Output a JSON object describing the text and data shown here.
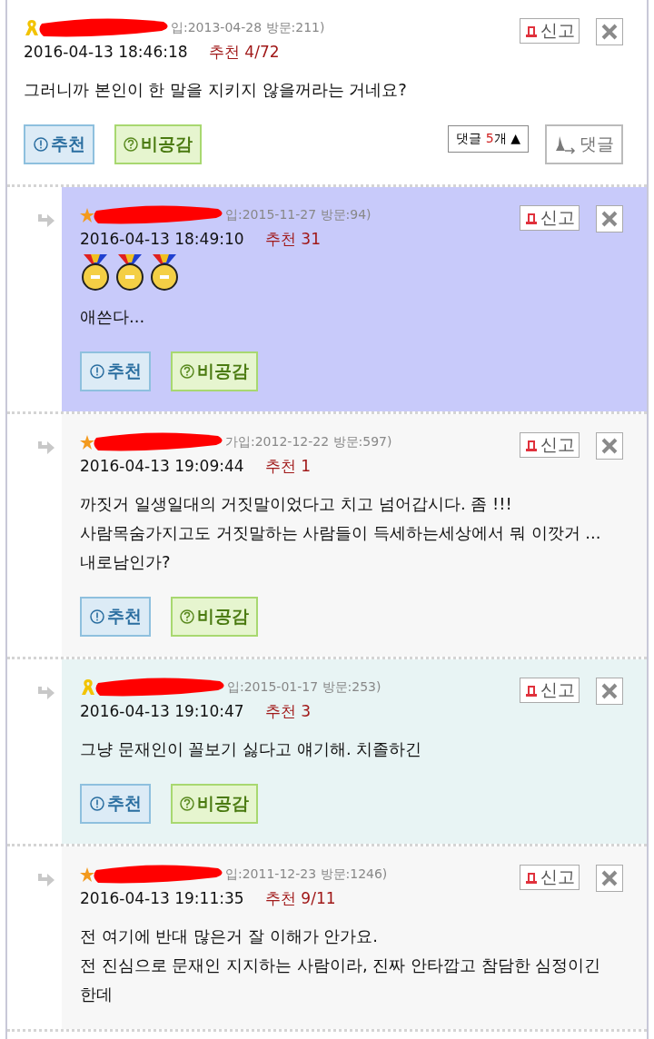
{
  "comments": [
    {
      "badge": {
        "kind": "ribbon"
      },
      "reply": false,
      "color": "#ffffff",
      "meta": "입:2013-04-28 방문:211)",
      "date": "2016-04-13 18:46:18",
      "votes": "추천 4/72",
      "body": [
        "그러니까 본인이 한 말을 지키지 않을꺼라는 거네요?"
      ],
      "report": "신고",
      "recommend": "추천",
      "dislike": "비공감",
      "thread": {
        "label": "댓글",
        "count": "5",
        "unit": "개",
        "arrow": "▲",
        "reply": "댓글"
      }
    },
    {
      "badge": {
        "kind": "star"
      },
      "reply": true,
      "color": "#c8cafa",
      "meta": "입:2015-11-27 방문:94)",
      "date": "2016-04-13 18:49:10",
      "votes": "추천 31",
      "awards": [
        {
          "kind": "medal"
        },
        {
          "kind": "medal"
        },
        {
          "kind": "medal"
        }
      ],
      "body": [
        "애쓴다..."
      ],
      "report": "신고",
      "recommend": "추천",
      "dislike": "비공감"
    },
    {
      "badge": {
        "kind": "star"
      },
      "reply": true,
      "color": "#f7f7f7",
      "meta": "가입:2012-12-22 방문:597)",
      "date": "2016-04-13 19:09:44",
      "votes": "추천 1",
      "body": [
        "까짓거 일생일대의 거짓말이었다고 치고 넘어갑시다. 좀 !!!",
        "사람목숨가지고도 거짓말하는 사람들이 득세하는세상에서 뭐 이깟거 ...",
        "내로남인가?"
      ],
      "report": "신고",
      "recommend": "추천",
      "dislike": "비공감"
    },
    {
      "badge": {
        "kind": "ribbon"
      },
      "reply": true,
      "color": "#e8f4f4",
      "meta": "입:2015-01-17 방문:253)",
      "date": "2016-04-13 19:10:47",
      "votes": "추천 3",
      "body": [
        "그냥 문재인이 꼴보기 싫다고 얘기해. 치졸하긴"
      ],
      "report": "신고",
      "recommend": "추천",
      "dislike": "비공감"
    },
    {
      "badge": {
        "kind": "star"
      },
      "reply": true,
      "color": "#f7f7f7",
      "meta": "입:2011-12-23 방문:1246)",
      "date": "2016-04-13 19:11:35",
      "votes": "추천 9/11",
      "body": [
        "전 여기에 반대 많은거 잘 이해가 안가요.",
        "전 진심으로 문재인 지지하는 사람이라, 진짜 안타깝고 참담한 심정이긴",
        "한데"
      ],
      "report": "신고"
    }
  ]
}
